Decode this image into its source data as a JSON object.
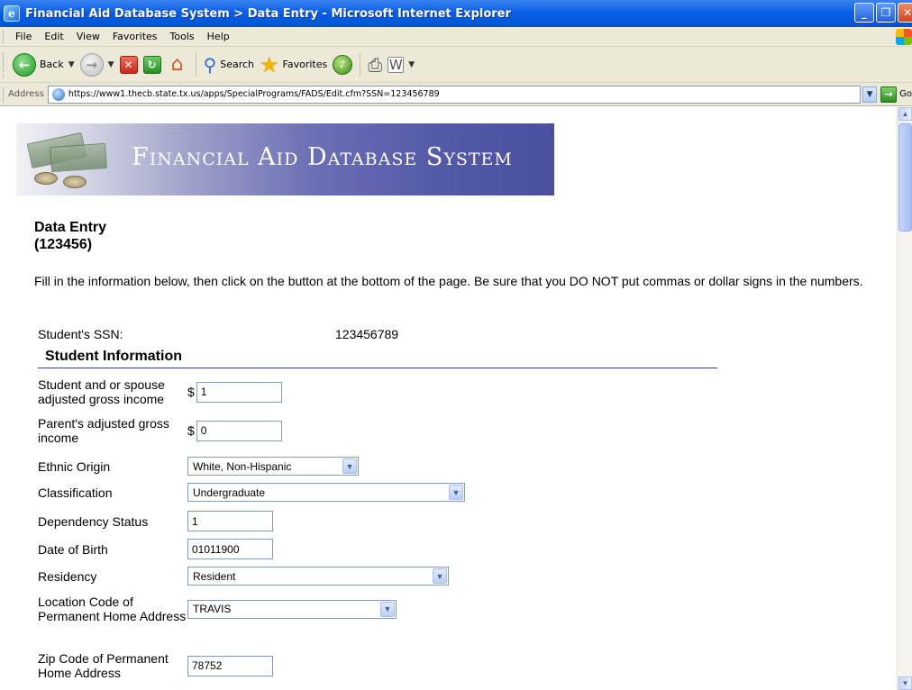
{
  "window": {
    "title": "Financial Aid Database System > Data Entry - Microsoft Internet Explorer",
    "minimize": "_",
    "maximize": "❐",
    "close": "✕"
  },
  "menu": [
    "File",
    "Edit",
    "View",
    "Favorites",
    "Tools",
    "Help"
  ],
  "toolbar": {
    "back_label": "Back",
    "search_label": "Search",
    "favorites_label": "Favorites"
  },
  "address": {
    "label": "Address",
    "url": "https://www1.thecb.state.tx.us/apps/SpecialPrograms/FADS/Edit.cfm?SSN=123456789",
    "go_label": "Go"
  },
  "banner": {
    "title": "Financial Aid Database System"
  },
  "page": {
    "heading_line1": "Data Entry",
    "heading_line2": "(123456)",
    "intro": "Fill in the information below, then click on the button at the bottom of the page. Be sure that you DO NOT put commas or dollar signs in the numbers."
  },
  "ssn": {
    "label": "Student's SSN:",
    "value": "123456789"
  },
  "section": {
    "title": "Student Information"
  },
  "fields": {
    "student_income": {
      "label": "Student and or spouse adjusted gross income",
      "prefix": "$",
      "value": "1"
    },
    "parent_income": {
      "label": "Parent's adjusted gross income",
      "prefix": "$",
      "value": "0"
    },
    "ethnic_origin": {
      "label": "Ethnic Origin",
      "value": "White, Non-Hispanic"
    },
    "classification": {
      "label": "Classification",
      "value": "Undergraduate"
    },
    "dependency": {
      "label": "Dependency Status",
      "value": "1"
    },
    "dob": {
      "label": "Date of Birth",
      "value": "01011900"
    },
    "residency": {
      "label": "Residency",
      "value": "Resident"
    },
    "location_code": {
      "label": "Location Code of Permanent Home Address",
      "value": "TRAVIS"
    },
    "zip": {
      "label": "Zip Code of Permanent Home Address",
      "value": "78752"
    }
  }
}
